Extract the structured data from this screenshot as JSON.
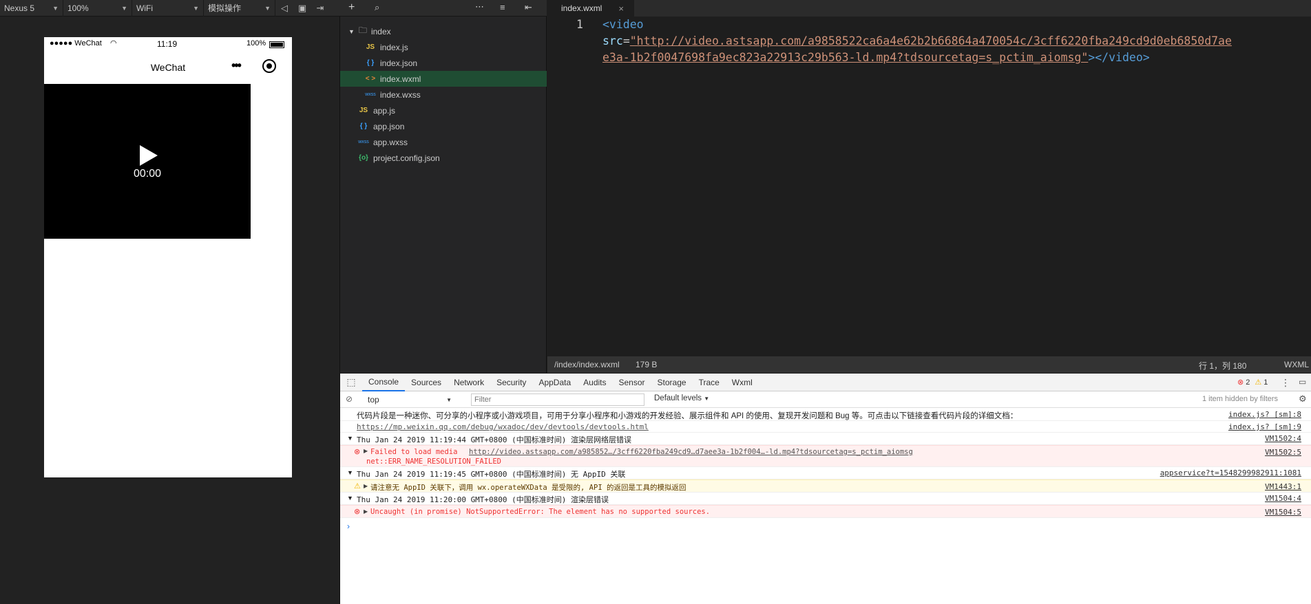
{
  "sim_toolbar": {
    "device": "Nexus 5",
    "zoom": "100%",
    "network": "WiFi",
    "action": "模拟操作"
  },
  "phone": {
    "signal": "●●●●● WeChat",
    "time": "11:19",
    "battery": "100%",
    "nav_title": "WeChat",
    "video_time": "00:00"
  },
  "tree": {
    "items": [
      {
        "label": "index",
        "icon": "folder-icon"
      },
      {
        "label": "index.js",
        "icon": "js-icon"
      },
      {
        "label": "index.json",
        "icon": "json-icon"
      },
      {
        "label": "index.wxml",
        "icon": "wxml-icon"
      },
      {
        "label": "index.wxss",
        "icon": "wxss-icon"
      },
      {
        "label": "app.js",
        "icon": "js-icon"
      },
      {
        "label": "app.json",
        "icon": "json-icon"
      },
      {
        "label": "app.wxss",
        "icon": "wxss-icon"
      },
      {
        "label": "project.config.json",
        "icon": "config-icon"
      }
    ],
    "icon_text": {
      "js": "JS",
      "json": "{ }",
      "wxml": "< >",
      "wxss": "wxss",
      "config": "{o}"
    }
  },
  "editor": {
    "tab": "index.wxml",
    "line_number": "1",
    "code_open": "<video",
    "code_attr": "src",
    "code_eq": "=",
    "code_url_1": "\"http://video.astsapp.com/a9858522ca6a4e62b2b66864a470054c/3cff6220fba249cd9d0eb6850d7ae",
    "code_url_2": "e3a-1b2f0047698fa9ec823a22913c29b563-ld.mp4?tdsourcetag=s_pctim_aiomsg\"",
    "code_close": "></video>",
    "status_path": "/index/index.wxml",
    "status_size": "179 B",
    "status_pos": "行 1，列 180",
    "status_lang": "WXML"
  },
  "devtools": {
    "tabs": [
      "Console",
      "Sources",
      "Network",
      "Security",
      "AppData",
      "Audits",
      "Sensor",
      "Storage",
      "Trace",
      "Wxml"
    ],
    "error_count": "2",
    "warn_count": "1",
    "context": "top",
    "filter_placeholder": "Filter",
    "levels": "Default levels",
    "hidden_info": "1 item hidden by filters",
    "logs": [
      {
        "text": "代码片段是一种迷你、可分享的小程序或小游戏项目，可用于分享小程序和小游戏的开发经验、展示组件和 API 的使用、复现开发问题和 Bug 等。可点击以下链接查看代码片段的详细文档：",
        "src": "index.js? [sm]:8"
      },
      {
        "text": "https://mp.weixin.qq.com/debug/wxadoc/dev/devtools/devtools.html",
        "src": "index.js? [sm]:9"
      },
      {
        "text": "Thu Jan 24 2019 11:19:44 GMT+0800 (中国标准时间) 渲染层网络层错误",
        "src": "VM1502:4"
      },
      {
        "text_a": "Failed to load media",
        "text_b": "http://video.astsapp.com/a985852…/3cff6220fba249cd9…d7aee3a-1b2f004…-ld.mp4?tdsourcetag=s_pctim_aiomsg",
        "text_c": "net::ERR_NAME_RESOLUTION_FAILED",
        "src": "VM1502:5"
      },
      {
        "text": "Thu Jan 24 2019 11:19:45 GMT+0800 (中国标准时间) 无 AppID 关联",
        "src": "appservice?t=1548299982911:1081"
      },
      {
        "text": "请注意无 AppID 关联下，调用 wx.operateWXData 是受限的, API 的返回是工具的模拟返回",
        "src": "VM1443:1"
      },
      {
        "text": "Thu Jan 24 2019 11:20:00 GMT+0800 (中国标准时间) 渲染层错误",
        "src": "VM1504:4"
      },
      {
        "text": "Uncaught (in promise) NotSupportedError: The element has no supported sources.",
        "src": "VM1504:5"
      }
    ]
  },
  "colors": {
    "tag": "#569cd6",
    "attr": "#9cdcfe",
    "string": "#ce9178",
    "selected_file": "#1f4d33",
    "error": "#e33",
    "warning": "#f0b400"
  }
}
